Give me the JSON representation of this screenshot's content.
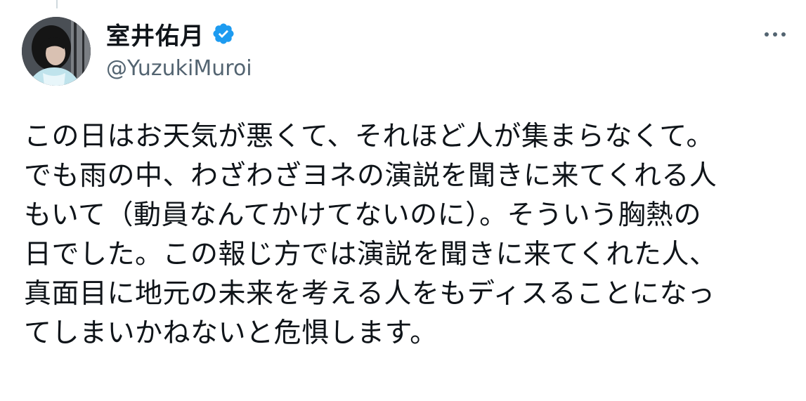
{
  "author": {
    "display_name": "室井佑月",
    "handle": "@YuzukiMuroi",
    "verified": true
  },
  "icons": {
    "verified": "verified-badge-icon",
    "more": "more-options-icon",
    "avatar": "profile-photo"
  },
  "colors": {
    "verified_badge": "#1d9bf0",
    "secondary_text": "#536471",
    "primary_text": "#0f1419"
  },
  "tweet": {
    "lines": [
      "この日はお天気が悪くて、それほど人が集まらなくて。",
      "でも雨の中、わざわざヨネの演説を聞きに来てくれる人",
      "もいて（動員なんてかけてないのに）。そういう胸熱の",
      "日でした。この報じ方では演説を聞きに来てくれた人、",
      "真面目に地元の未来を考える人をもディスることになっ",
      "てしまいかねないと危惧します。"
    ]
  }
}
